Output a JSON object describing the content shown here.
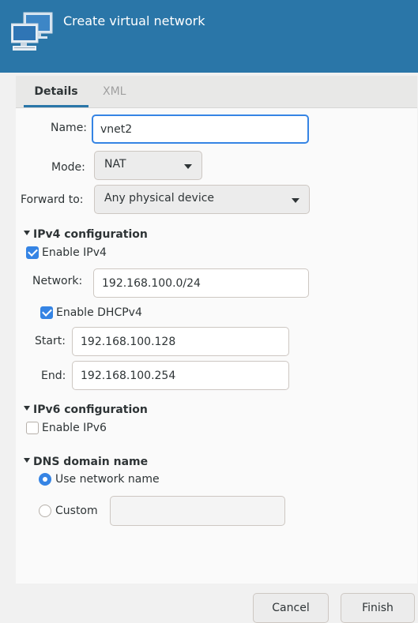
{
  "window": {
    "title": "Create virtual network"
  },
  "tabs": [
    {
      "label": "Details",
      "active": true
    },
    {
      "label": "XML",
      "active": false
    }
  ],
  "name": {
    "label": "Name:",
    "value": "vnet2"
  },
  "mode": {
    "label": "Mode:",
    "value": "NAT"
  },
  "forward": {
    "label": "Forward to:",
    "value": "Any physical device"
  },
  "ipv4": {
    "title": "IPv4 configuration",
    "enable_label": "Enable IPv4",
    "enabled": true,
    "network_label": "Network:",
    "network_value": "192.168.100.0/24",
    "dhcp_label": "Enable DHCPv4",
    "dhcp_enabled": true,
    "start_label": "Start:",
    "start_value": "192.168.100.128",
    "end_label": "End:",
    "end_value": "192.168.100.254"
  },
  "ipv6": {
    "title": "IPv6 configuration",
    "enable_label": "Enable IPv6",
    "enabled": false
  },
  "dns": {
    "title": "DNS domain name",
    "use_network_label": "Use network name",
    "custom_label": "Custom",
    "custom_value": ""
  },
  "buttons": {
    "cancel": "Cancel",
    "finish": "Finish"
  },
  "colors": {
    "header": "#2a76a8",
    "accent": "#3584e4"
  },
  "icons": {
    "header": "network-computers-icon"
  }
}
